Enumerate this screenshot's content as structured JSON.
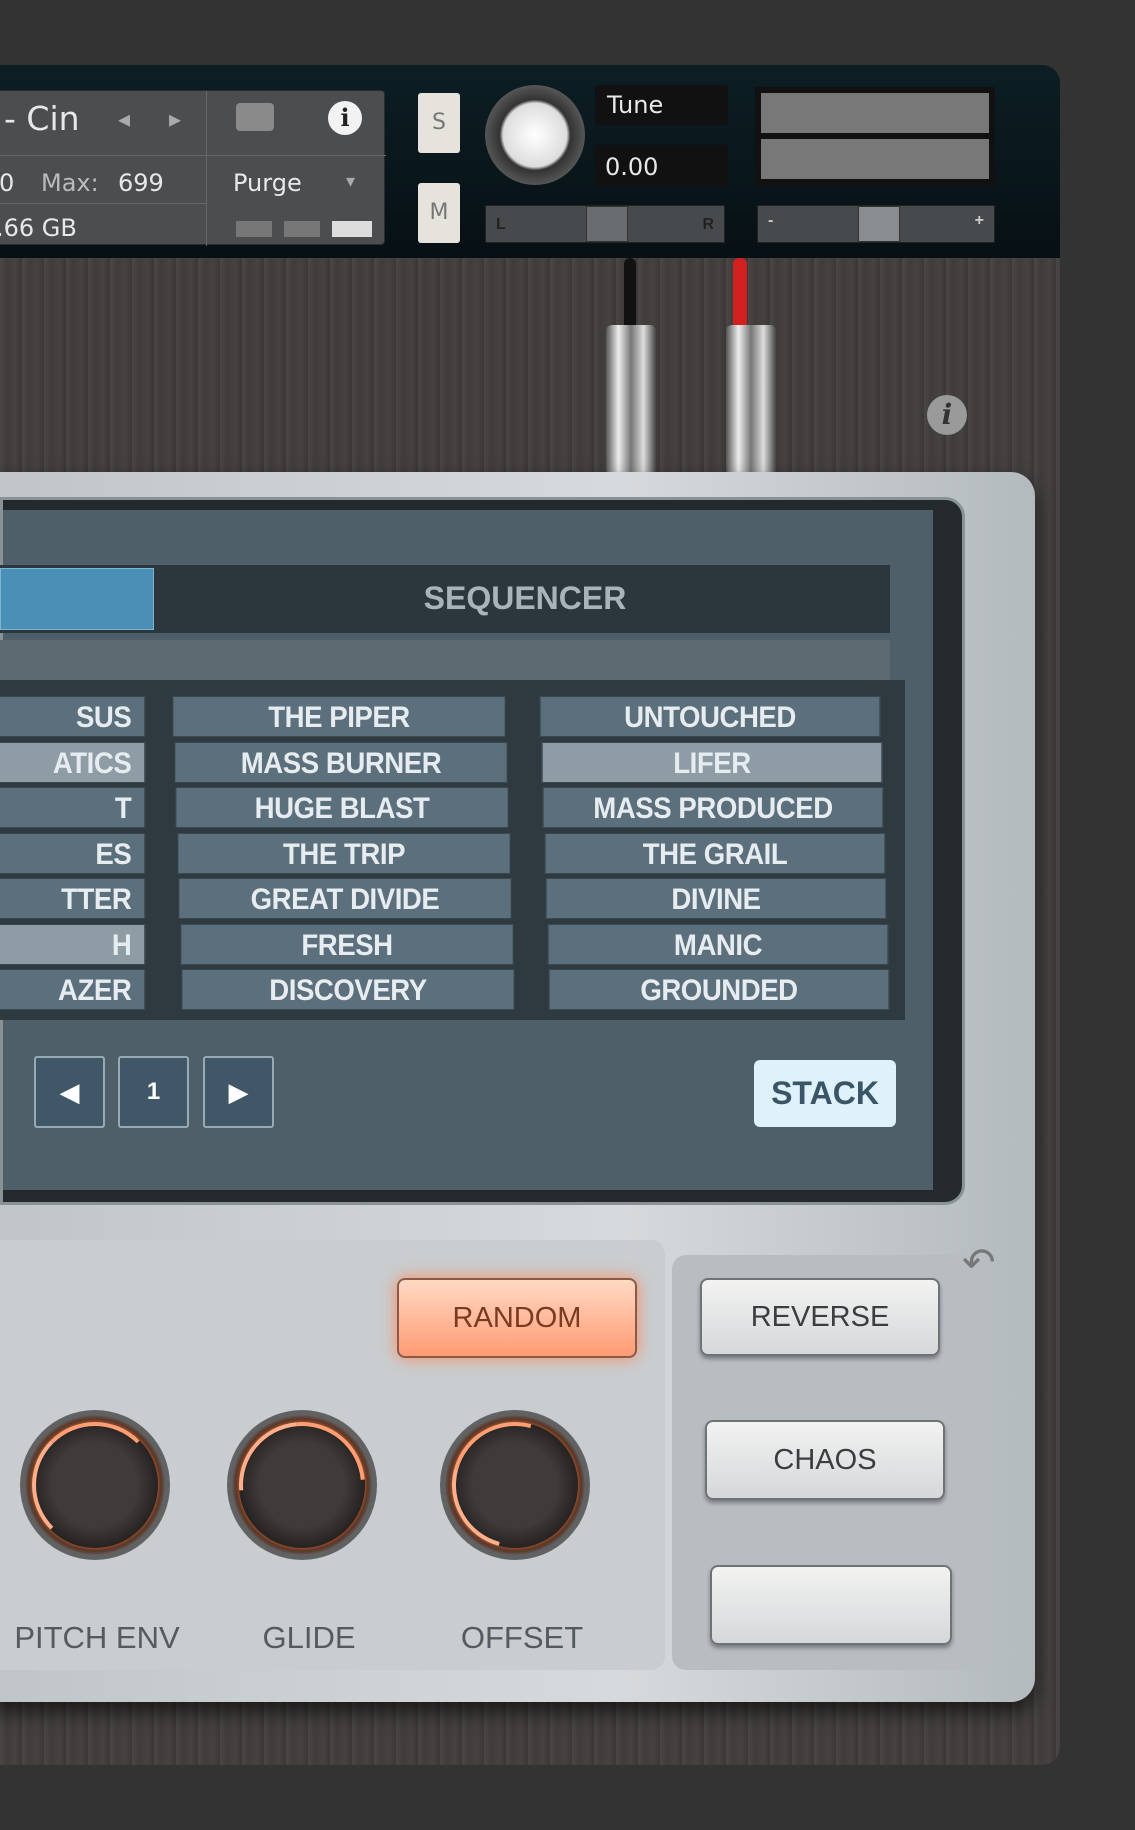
{
  "header": {
    "instrument_name": "- Cin",
    "max_label": "Max:",
    "max_value": "699",
    "voices_value": "0",
    "memory": ".66 GB",
    "purge_label": "Purge",
    "solo_label": "S",
    "mute_label": "M",
    "tune_label": "Tune",
    "tune_value": "0.00",
    "pan_left": "L",
    "pan_right": "R",
    "vol_minus": "-",
    "vol_plus": "+"
  },
  "screen": {
    "tab_active_label": "",
    "tab_sequencer": "SEQUENCER",
    "columns": [
      [
        "SUS",
        "ATICS",
        "T",
        "ES",
        "TTER",
        "H",
        "AZER"
      ],
      [
        "THE PIPER",
        "MASS BURNER",
        "HUGE BLAST",
        "THE TRIP",
        "GREAT DIVIDE",
        "FRESH",
        "DISCOVERY"
      ],
      [
        "UNTOUCHED",
        "LIFER",
        "MASS PRODUCED",
        "THE GRAIL",
        "DIVINE",
        "MANIC",
        "GROUNDED"
      ]
    ],
    "selected": [
      "ATICS",
      "H",
      "LIFER"
    ],
    "page": "1",
    "stack_label": "STACK"
  },
  "controls": {
    "random_label": "RANDOM",
    "reverse_label": "REVERSE",
    "chaos_label": "CHAOS",
    "blank_label": "",
    "knobs": [
      {
        "label": "PITCH ENV"
      },
      {
        "label": "GLIDE"
      },
      {
        "label": "OFFSET"
      }
    ]
  },
  "colors": {
    "accent_blue": "#4a8fb5",
    "cable_red": "#d21f1f",
    "random_glow": "#ff8a5c"
  }
}
